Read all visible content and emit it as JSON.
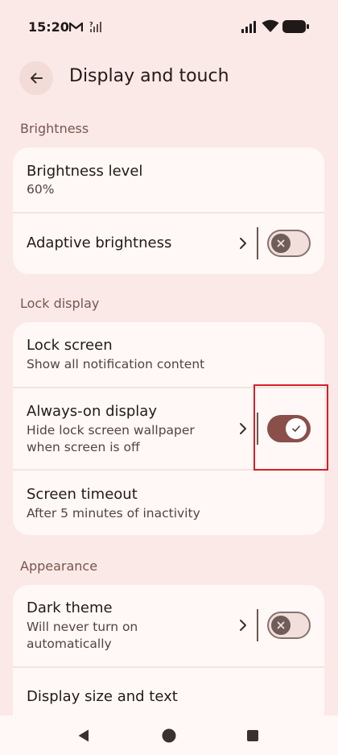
{
  "status_bar": {
    "time": "15:20",
    "icons": [
      "gmail-icon",
      "no-signal-icon",
      "signal-icon",
      "wifi-icon",
      "battery-icon"
    ]
  },
  "header": {
    "title": "Display and touch",
    "back_icon": "arrow-back-icon"
  },
  "sections": {
    "brightness": {
      "header": "Brightness",
      "brightness_level": {
        "title": "Brightness level",
        "value": "60%"
      },
      "adaptive_brightness": {
        "title": "Adaptive brightness",
        "toggle": "off"
      }
    },
    "lock_display": {
      "header": "Lock display",
      "lock_screen": {
        "title": "Lock screen",
        "subtitle": "Show all notification content"
      },
      "always_on": {
        "title": "Always-on display",
        "subtitle_line1": "Hide lock screen wallpaper",
        "subtitle_line2": "when screen is off",
        "toggle": "on"
      },
      "screen_timeout": {
        "title": "Screen timeout",
        "subtitle": "After 5 minutes of inactivity"
      }
    },
    "appearance": {
      "header": "Appearance",
      "dark_theme": {
        "title": "Dark theme",
        "subtitle_line1": "Will never turn on",
        "subtitle_line2": "automatically",
        "toggle": "off"
      },
      "display_size": {
        "title": "Display size and text"
      }
    }
  },
  "navbar": {
    "icons": [
      "back-triangle-icon",
      "home-circle-icon",
      "recents-square-icon"
    ]
  },
  "colors": {
    "background": "#fbe9e7",
    "card": "#fff8f6",
    "accent": "#8b4f4a",
    "section_header": "#775651",
    "highlight": "#d51f26"
  }
}
